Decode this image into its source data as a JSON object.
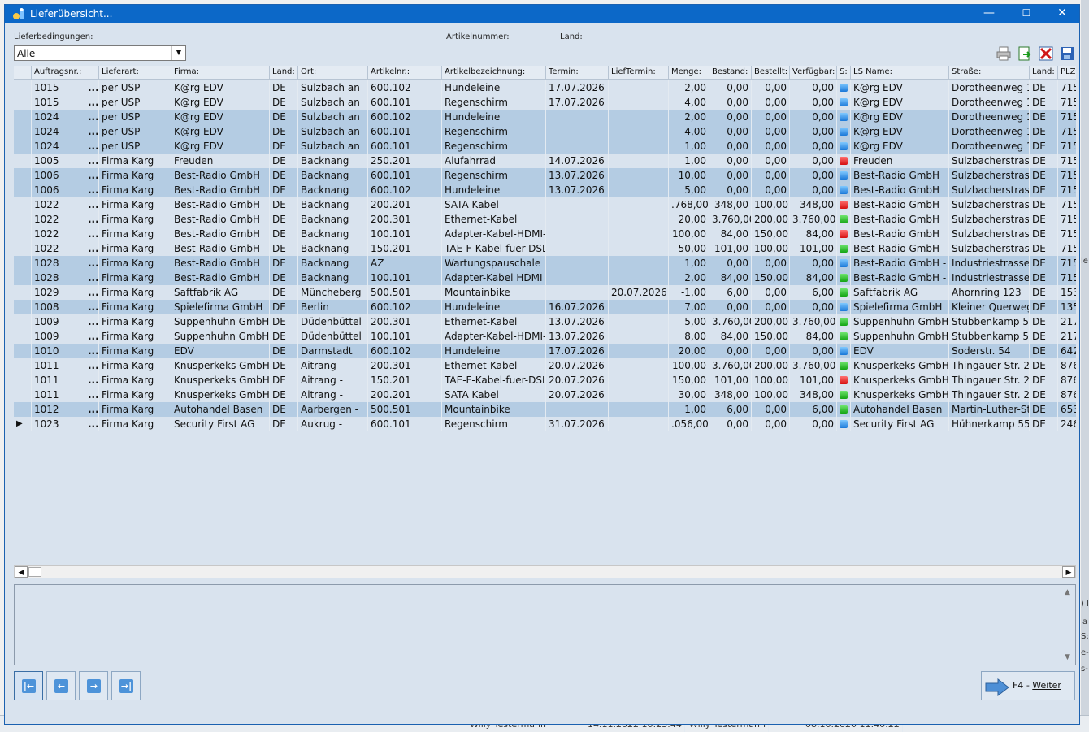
{
  "window": {
    "title": "Lieferübersicht...",
    "min": "—",
    "max": "☐",
    "close": "✕"
  },
  "filters": {
    "lieferbedingungen_label": "Lieferbedingungen:",
    "lieferbedingungen_value": "Alle",
    "artikelnummer_label": "Artikelnummer:",
    "land_label": "Land:"
  },
  "toolbar": {
    "print": "printer-icon",
    "export": "export-icon",
    "delete": "delete-icon",
    "save": "save-icon"
  },
  "colors": {
    "selected_row": "#b4cce3",
    "background": "#d9e3ee",
    "titlebar": "#0c68c8"
  },
  "table": {
    "headers": [
      "",
      "Auftragsnr.:",
      "",
      "Lieferart:",
      "Firma:",
      "Land:",
      "Ort:",
      "Artikelnr.:",
      "Artikelbezeichnung:",
      "Termin:",
      "LiefTermin:",
      "Menge:",
      "Bestand:",
      "Bestellt:",
      "Verfügbar:",
      "S:",
      "LS Name:",
      "Straße:",
      "Land:",
      "PLZ:"
    ],
    "rows": [
      {
        "sel": false,
        "cur": "",
        "nr": "1015",
        "dots": "...",
        "art": "per USP",
        "firma": "K@rg EDV",
        "land": "DE",
        "ort": "Sulzbach an",
        "artnr": "600.102",
        "bez": "Hundeleine",
        "termin": "17.07.2026",
        "lterm": "",
        "menge": "2,00",
        "bestand": "0,00",
        "bestellt": "0,00",
        "verf": "0,00",
        "s": "blue",
        "ls": "K@rg EDV",
        "strasse": "Dorotheenweg 1",
        "land2": "DE",
        "plz": "715"
      },
      {
        "sel": false,
        "cur": "",
        "nr": "1015",
        "dots": "...",
        "art": "per USP",
        "firma": "K@rg EDV",
        "land": "DE",
        "ort": "Sulzbach an",
        "artnr": "600.101",
        "bez": "Regenschirm",
        "termin": "17.07.2026",
        "lterm": "",
        "menge": "4,00",
        "bestand": "0,00",
        "bestellt": "0,00",
        "verf": "0,00",
        "s": "blue",
        "ls": "K@rg EDV",
        "strasse": "Dorotheenweg 1",
        "land2": "DE",
        "plz": "715"
      },
      {
        "sel": true,
        "cur": "",
        "nr": "1024",
        "dots": "...",
        "art": "per USP",
        "firma": "K@rg EDV",
        "land": "DE",
        "ort": "Sulzbach an",
        "artnr": "600.102",
        "bez": "Hundeleine",
        "termin": "",
        "lterm": "",
        "menge": "2,00",
        "bestand": "0,00",
        "bestellt": "0,00",
        "verf": "0,00",
        "s": "blue",
        "ls": "K@rg EDV",
        "strasse": "Dorotheenweg 1",
        "land2": "DE",
        "plz": "715"
      },
      {
        "sel": true,
        "cur": "",
        "nr": "1024",
        "dots": "...",
        "art": "per USP",
        "firma": "K@rg EDV",
        "land": "DE",
        "ort": "Sulzbach an",
        "artnr": "600.101",
        "bez": "Regenschirm",
        "termin": "",
        "lterm": "",
        "menge": "4,00",
        "bestand": "0,00",
        "bestellt": "0,00",
        "verf": "0,00",
        "s": "blue",
        "ls": "K@rg EDV",
        "strasse": "Dorotheenweg 1",
        "land2": "DE",
        "plz": "715"
      },
      {
        "sel": true,
        "cur": "",
        "nr": "1024",
        "dots": "...",
        "art": "per USP",
        "firma": "K@rg EDV",
        "land": "DE",
        "ort": "Sulzbach an",
        "artnr": "600.101",
        "bez": "Regenschirm",
        "termin": "",
        "lterm": "",
        "menge": "1,00",
        "bestand": "0,00",
        "bestellt": "0,00",
        "verf": "0,00",
        "s": "blue",
        "ls": "K@rg EDV",
        "strasse": "Dorotheenweg 1",
        "land2": "DE",
        "plz": "715"
      },
      {
        "sel": false,
        "cur": "",
        "nr": "1005",
        "dots": "...",
        "art": "Firma Karg",
        "firma": "Freuden",
        "land": "DE",
        "ort": "Backnang",
        "artnr": "250.201",
        "bez": "Alufahrrad",
        "termin": "14.07.2026",
        "lterm": "",
        "menge": "1,00",
        "bestand": "0,00",
        "bestellt": "0,00",
        "verf": "0,00",
        "s": "red",
        "ls": "Freuden",
        "strasse": "Sulzbacherstrass",
        "land2": "DE",
        "plz": "715"
      },
      {
        "sel": true,
        "cur": "",
        "nr": "1006",
        "dots": "...",
        "art": "Firma Karg",
        "firma": "Best-Radio GmbH",
        "land": "DE",
        "ort": "Backnang",
        "artnr": "600.101",
        "bez": "Regenschirm",
        "termin": "13.07.2026",
        "lterm": "",
        "menge": "10,00",
        "bestand": "0,00",
        "bestellt": "0,00",
        "verf": "0,00",
        "s": "blue",
        "ls": "Best-Radio GmbH",
        "strasse": "Sulzbacherstrass",
        "land2": "DE",
        "plz": "715"
      },
      {
        "sel": true,
        "cur": "",
        "nr": "1006",
        "dots": "...",
        "art": "Firma Karg",
        "firma": "Best-Radio GmbH",
        "land": "DE",
        "ort": "Backnang",
        "artnr": "600.102",
        "bez": "Hundeleine",
        "termin": "13.07.2026",
        "lterm": "",
        "menge": "5,00",
        "bestand": "0,00",
        "bestellt": "0,00",
        "verf": "0,00",
        "s": "blue",
        "ls": "Best-Radio GmbH",
        "strasse": "Sulzbacherstrass",
        "land2": "DE",
        "plz": "715"
      },
      {
        "sel": false,
        "cur": "",
        "nr": "1022",
        "dots": "...",
        "art": "Firma Karg",
        "firma": "Best-Radio GmbH",
        "land": "DE",
        "ort": "Backnang",
        "artnr": "200.201",
        "bez": "SATA Kabel",
        "termin": "",
        "lterm": "",
        "menge": ".768,00",
        "bestand": "348,00",
        "bestellt": "100,00",
        "verf": "348,00",
        "s": "red",
        "ls": "Best-Radio GmbH",
        "strasse": "Sulzbacherstrass",
        "land2": "DE",
        "plz": "715"
      },
      {
        "sel": false,
        "cur": "",
        "nr": "1022",
        "dots": "...",
        "art": "Firma Karg",
        "firma": "Best-Radio GmbH",
        "land": "DE",
        "ort": "Backnang",
        "artnr": "200.301",
        "bez": "Ethernet-Kabel",
        "termin": "",
        "lterm": "",
        "menge": "20,00",
        "bestand": "3.760,00",
        "bestellt": "200,00",
        "verf": "3.760,00",
        "s": "green",
        "ls": "Best-Radio GmbH",
        "strasse": "Sulzbacherstrass",
        "land2": "DE",
        "plz": "715"
      },
      {
        "sel": false,
        "cur": "",
        "nr": "1022",
        "dots": "...",
        "art": "Firma Karg",
        "firma": "Best-Radio GmbH",
        "land": "DE",
        "ort": "Backnang",
        "artnr": "100.101",
        "bez": "Adapter-Kabel-HDMI-H",
        "termin": "",
        "lterm": "",
        "menge": "100,00",
        "bestand": "84,00",
        "bestellt": "150,00",
        "verf": "84,00",
        "s": "red",
        "ls": "Best-Radio GmbH",
        "strasse": "Sulzbacherstrass",
        "land2": "DE",
        "plz": "715"
      },
      {
        "sel": false,
        "cur": "",
        "nr": "1022",
        "dots": "...",
        "art": "Firma Karg",
        "firma": "Best-Radio GmbH",
        "land": "DE",
        "ort": "Backnang",
        "artnr": "150.201",
        "bez": "TAE-F-Kabel-fuer-DSL-S",
        "termin": "",
        "lterm": "",
        "menge": "50,00",
        "bestand": "101,00",
        "bestellt": "100,00",
        "verf": "101,00",
        "s": "green",
        "ls": "Best-Radio GmbH",
        "strasse": "Sulzbacherstrass",
        "land2": "DE",
        "plz": "715"
      },
      {
        "sel": true,
        "cur": "",
        "nr": "1028",
        "dots": "...",
        "art": "Firma Karg",
        "firma": "Best-Radio GmbH",
        "land": "DE",
        "ort": "Backnang",
        "artnr": "AZ",
        "bez": "Wartungspauschale",
        "termin": "",
        "lterm": "",
        "menge": "1,00",
        "bestand": "0,00",
        "bestellt": "0,00",
        "verf": "0,00",
        "s": "blue",
        "ls": "Best-Radio GmbH -",
        "strasse": "Industriestrasse",
        "land2": "DE",
        "plz": "715"
      },
      {
        "sel": true,
        "cur": "",
        "nr": "1028",
        "dots": "...",
        "art": "Firma Karg",
        "firma": "Best-Radio GmbH",
        "land": "DE",
        "ort": "Backnang",
        "artnr": "100.101",
        "bez": "Adapter-Kabel HDMI",
        "termin": "",
        "lterm": "",
        "menge": "2,00",
        "bestand": "84,00",
        "bestellt": "150,00",
        "verf": "84,00",
        "s": "green",
        "ls": "Best-Radio GmbH -",
        "strasse": "Industriestrasse",
        "land2": "DE",
        "plz": "715"
      },
      {
        "sel": false,
        "cur": "",
        "nr": "1029",
        "dots": "...",
        "art": "Firma Karg",
        "firma": "Saftfabrik AG",
        "land": "DE",
        "ort": "Müncheberg",
        "artnr": "500.501",
        "bez": "Mountainbike",
        "termin": "",
        "lterm": "20.07.2026",
        "menge": "-1,00",
        "bestand": "6,00",
        "bestellt": "0,00",
        "verf": "6,00",
        "s": "green",
        "ls": "Saftfabrik AG",
        "strasse": "Ahornring 123",
        "land2": "DE",
        "plz": "153"
      },
      {
        "sel": true,
        "cur": "",
        "nr": "1008",
        "dots": "...",
        "art": "Firma Karg",
        "firma": "Spielefirma GmbH",
        "land": "DE",
        "ort": "Berlin",
        "artnr": "600.102",
        "bez": "Hundeleine",
        "termin": "16.07.2026",
        "lterm": "",
        "menge": "7,00",
        "bestand": "0,00",
        "bestellt": "0,00",
        "verf": "0,00",
        "s": "blue",
        "ls": "Spielefirma GmbH",
        "strasse": "Kleiner Querweg",
        "land2": "DE",
        "plz": "135"
      },
      {
        "sel": false,
        "cur": "",
        "nr": "1009",
        "dots": "...",
        "art": "Firma Karg",
        "firma": "Suppenhuhn GmbH",
        "land": "DE",
        "ort": "Düdenbüttel",
        "artnr": "200.301",
        "bez": "Ethernet-Kabel",
        "termin": "13.07.2026",
        "lterm": "",
        "menge": "5,00",
        "bestand": "3.760,00",
        "bestellt": "200,00",
        "verf": "3.760,00",
        "s": "green",
        "ls": "Suppenhuhn GmbH",
        "strasse": "Stubbenkamp 55",
        "land2": "DE",
        "plz": "217"
      },
      {
        "sel": false,
        "cur": "",
        "nr": "1009",
        "dots": "...",
        "art": "Firma Karg",
        "firma": "Suppenhuhn GmbH",
        "land": "DE",
        "ort": "Düdenbüttel",
        "artnr": "100.101",
        "bez": "Adapter-Kabel-HDMI-H",
        "termin": "13.07.2026",
        "lterm": "",
        "menge": "8,00",
        "bestand": "84,00",
        "bestellt": "150,00",
        "verf": "84,00",
        "s": "green",
        "ls": "Suppenhuhn GmbH",
        "strasse": "Stubbenkamp 55",
        "land2": "DE",
        "plz": "217"
      },
      {
        "sel": true,
        "cur": "",
        "nr": "1010",
        "dots": "...",
        "art": "Firma Karg",
        "firma": "EDV",
        "land": "DE",
        "ort": "Darmstadt",
        "artnr": "600.102",
        "bez": "Hundeleine",
        "termin": "17.07.2026",
        "lterm": "",
        "menge": "20,00",
        "bestand": "0,00",
        "bestellt": "0,00",
        "verf": "0,00",
        "s": "blue",
        "ls": "EDV",
        "strasse": "Soderstr. 54",
        "land2": "DE",
        "plz": "642"
      },
      {
        "sel": false,
        "cur": "",
        "nr": "1011",
        "dots": "...",
        "art": "Firma Karg",
        "firma": "Knusperkeks GmbH",
        "land": "DE",
        "ort": "Aitrang -",
        "artnr": "200.301",
        "bez": "Ethernet-Kabel",
        "termin": "20.07.2026",
        "lterm": "",
        "menge": "100,00",
        "bestand": "3.760,00",
        "bestellt": "200,00",
        "verf": "3.760,00",
        "s": "green",
        "ls": "Knusperkeks GmbH",
        "strasse": "Thingauer Str. 22",
        "land2": "DE",
        "plz": "876"
      },
      {
        "sel": false,
        "cur": "",
        "nr": "1011",
        "dots": "...",
        "art": "Firma Karg",
        "firma": "Knusperkeks GmbH",
        "land": "DE",
        "ort": "Aitrang -",
        "artnr": "150.201",
        "bez": "TAE-F-Kabel-fuer-DSL-S",
        "termin": "20.07.2026",
        "lterm": "",
        "menge": "150,00",
        "bestand": "101,00",
        "bestellt": "100,00",
        "verf": "101,00",
        "s": "red",
        "ls": "Knusperkeks GmbH",
        "strasse": "Thingauer Str. 22",
        "land2": "DE",
        "plz": "876"
      },
      {
        "sel": false,
        "cur": "",
        "nr": "1011",
        "dots": "...",
        "art": "Firma Karg",
        "firma": "Knusperkeks GmbH",
        "land": "DE",
        "ort": "Aitrang -",
        "artnr": "200.201",
        "bez": "SATA Kabel",
        "termin": "20.07.2026",
        "lterm": "",
        "menge": "30,00",
        "bestand": "348,00",
        "bestellt": "100,00",
        "verf": "348,00",
        "s": "green",
        "ls": "Knusperkeks GmbH",
        "strasse": "Thingauer Str. 22",
        "land2": "DE",
        "plz": "876"
      },
      {
        "sel": true,
        "cur": "",
        "nr": "1012",
        "dots": "...",
        "art": "Firma Karg",
        "firma": "Autohandel Basen",
        "land": "DE",
        "ort": "Aarbergen -",
        "artnr": "500.501",
        "bez": "Mountainbike",
        "termin": "",
        "lterm": "",
        "menge": "1,00",
        "bestand": "6,00",
        "bestellt": "0,00",
        "verf": "6,00",
        "s": "green",
        "ls": "Autohandel Basen",
        "strasse": "Martin-Luther-Str",
        "land2": "DE",
        "plz": "653"
      },
      {
        "sel": false,
        "cur": "▶",
        "nr": "1023",
        "dots": "...",
        "art": "Firma Karg",
        "firma": "Security First AG",
        "land": "DE",
        "ort": "Aukrug -",
        "artnr": "600.101",
        "bez": "Regenschirm",
        "termin": "31.07.2026",
        "lterm": "",
        "menge": ".056,00",
        "bestand": "0,00",
        "bestellt": "0,00",
        "verf": "0,00",
        "s": "blue",
        "ls": "Security First AG",
        "strasse": "Hühnerkamp 55",
        "land2": "DE",
        "plz": "246"
      }
    ]
  },
  "scroll": {
    "left": "◀",
    "right": "▶",
    "up": "▲",
    "down": "▼"
  },
  "nav": {
    "first": "|←",
    "prev": "←",
    "next": "→",
    "last": "→|"
  },
  "weiter": {
    "prefix": "F4 - ",
    "label": "Weiter"
  },
  "background": {
    "edge_labels": [
      "le",
      ") l",
      "a",
      "S:",
      "e-",
      "s-"
    ],
    "bottom_texts": [
      "Willy Testermann",
      "14.11.2022 10:23:44",
      "Willy Testermann",
      "08.10.2020 11:40:22"
    ]
  }
}
